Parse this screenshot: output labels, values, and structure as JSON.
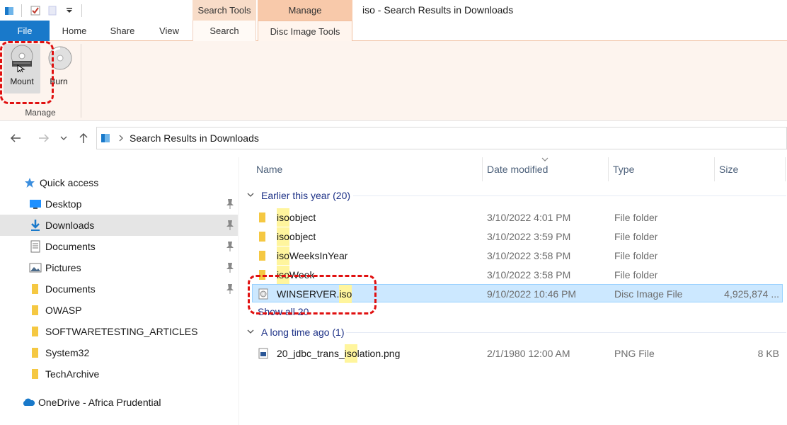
{
  "titlebar": {
    "window_title": "iso - Search Results in Downloads",
    "context_tabs": {
      "search_tools": "Search Tools",
      "manage": "Manage"
    }
  },
  "ribbon_tabs": {
    "file": "File",
    "home": "Home",
    "share": "Share",
    "view": "View",
    "search": "Search",
    "disc_image_tools": "Disc Image Tools"
  },
  "ribbon": {
    "mount": "Mount",
    "burn": "Burn",
    "group": "Manage"
  },
  "address": {
    "path": "Search Results in Downloads"
  },
  "navpane": {
    "items": [
      {
        "label": "Quick access",
        "icon": "star-icon"
      },
      {
        "label": "Desktop",
        "icon": "desktop-icon"
      },
      {
        "label": "Downloads",
        "icon": "download-icon"
      },
      {
        "label": "Documents",
        "icon": "documents-icon"
      },
      {
        "label": "Pictures",
        "icon": "pictures-icon"
      },
      {
        "label": "Documents",
        "icon": "folder-icon"
      },
      {
        "label": "OWASP",
        "icon": "folder-icon"
      },
      {
        "label": "SOFTWARETESTING_ARTICLES",
        "icon": "folder-icon"
      },
      {
        "label": "System32",
        "icon": "folder-icon"
      },
      {
        "label": "TechArchive",
        "icon": "folder-icon"
      },
      {
        "label": "OneDrive - Africa Prudential",
        "icon": "cloud-icon"
      }
    ]
  },
  "filelist": {
    "columns": {
      "name": "Name",
      "date": "Date modified",
      "type": "Type",
      "size": "Size"
    },
    "groups": [
      {
        "label": "Earlier this year (20)"
      },
      {
        "label": "A long time ago (1)"
      }
    ],
    "rows": [
      {
        "pre": "",
        "hl": "iso",
        "post": "object",
        "date": "3/10/2022 4:01 PM",
        "type": "File folder",
        "size": ""
      },
      {
        "pre": "",
        "hl": "iso",
        "post": "object",
        "date": "3/10/2022 3:59 PM",
        "type": "File folder",
        "size": ""
      },
      {
        "pre": "",
        "hl": "iso",
        "post": "WeeksInYear",
        "date": "3/10/2022 3:58 PM",
        "type": "File folder",
        "size": ""
      },
      {
        "pre": "",
        "hl": "iso",
        "post": "Week",
        "date": "3/10/2022 3:58 PM",
        "type": "File folder",
        "size": ""
      },
      {
        "pre": "WINSERVER.",
        "hl": "iso",
        "post": "",
        "date": "9/10/2022 10:46 PM",
        "type": "Disc Image File",
        "size": "4,925,874 ..."
      },
      {
        "pre": "20_jdbc_trans_",
        "hl": "iso",
        "post": "lation.png",
        "date": "2/1/1980 12:00 AM",
        "type": "PNG File",
        "size": "8 KB"
      }
    ],
    "show_all": "Show all 20"
  },
  "colors": {
    "accent": "#1979ca",
    "highlight": "#fff59d",
    "selection": "#cce8ff",
    "annotation": "#e01010"
  }
}
